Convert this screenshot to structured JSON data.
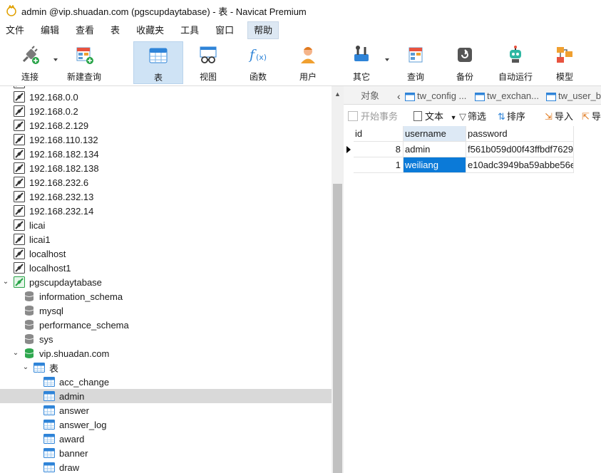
{
  "window": {
    "title": "admin @vip.shuadan.com (pgscupdaytabase) - 表 - Navicat Premium"
  },
  "menu": [
    "文件",
    "编辑",
    "查看",
    "表",
    "收藏夹",
    "工具",
    "窗口",
    "帮助"
  ],
  "toolbar": {
    "connect": "连接",
    "new_query": "新建查询",
    "table": "表",
    "view": "视图",
    "function": "函数",
    "user": "用户",
    "other": "其它",
    "query": "查询",
    "backup": "备份",
    "automation": "自动运行",
    "model": "模型"
  },
  "tree": {
    "connections": [
      "192.168.0.0",
      "192.168.0.2",
      "192.168.2.129",
      "192.168.110.132",
      "192.168.182.134",
      "192.168.182.138",
      "192.168.232.6",
      "192.168.232.13",
      "192.168.232.14",
      "licai",
      "licai1",
      "localhost",
      "localhost1"
    ],
    "open_connection": "pgscupdaytabase",
    "databases": [
      "information_schema",
      "mysql",
      "performance_schema",
      "sys"
    ],
    "open_database": "vip.shuadan.com",
    "tables_group": "表",
    "tables": [
      "acc_change",
      "admin",
      "answer",
      "answer_log",
      "award",
      "banner",
      "draw"
    ],
    "selected_table": "admin"
  },
  "tabs": {
    "objects": "对象",
    "t1": "tw_config ...",
    "t2": "tw_exchan...",
    "t3": "tw_user_b"
  },
  "subtoolbar": {
    "begin_tx": "开始事务",
    "text": "文本",
    "filter": "筛选",
    "sort": "排序",
    "import": "导入",
    "export": "导"
  },
  "grid": {
    "columns": [
      "id",
      "username",
      "password"
    ],
    "rows": [
      {
        "id": "8",
        "username": "admin",
        "password": "f561b059d00f43ffbdf7629"
      },
      {
        "id": "1",
        "username": "weiliang",
        "password": "e10adc3949ba59abbe56e"
      }
    ]
  },
  "colors": {
    "accent": "#0b7ad8",
    "toolbar_active": "#cfe3f5",
    "tree_selected": "#d9d9d9"
  }
}
